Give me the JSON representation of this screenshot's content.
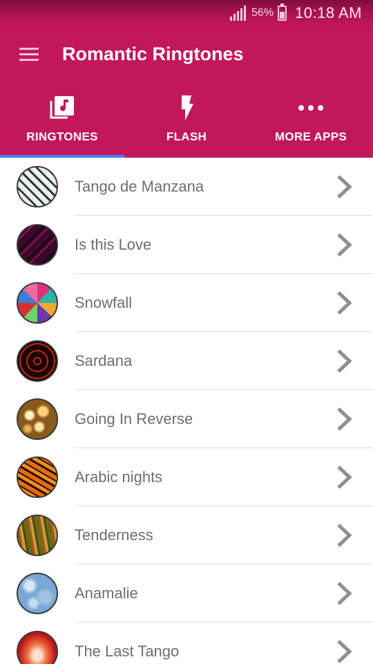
{
  "status_bar": {
    "battery_percent": "56%",
    "time": "10:18 AM"
  },
  "app_bar": {
    "menu_icon": "hamburger-menu-icon",
    "title": "Romantic Ringtones"
  },
  "tabs": [
    {
      "label": "RINGTONES",
      "icon": "music-library-icon",
      "selected": true
    },
    {
      "label": "FLASH",
      "icon": "flash-icon",
      "selected": false
    },
    {
      "label": "MORE APPS",
      "icon": "more-dots-icon",
      "selected": false
    }
  ],
  "theme": {
    "primary": "#c2185b",
    "tab_indicator": "#4a7ee8",
    "text_secondary": "#6e6e6e"
  },
  "ringtones": [
    {
      "name": "Tango de Manzana",
      "thumbnail": "diagonal-stripes"
    },
    {
      "name": "Is this Love",
      "thumbnail": "dark-magenta-stripes"
    },
    {
      "name": "Snowfall",
      "thumbnail": "colorful-triangles"
    },
    {
      "name": "Sardana",
      "thumbnail": "red-light-swirl"
    },
    {
      "name": "Going In Reverse",
      "thumbnail": "golden-bokeh"
    },
    {
      "name": "Arabic nights",
      "thumbnail": "orange-zebra"
    },
    {
      "name": "Tenderness",
      "thumbnail": "olive-curves"
    },
    {
      "name": "Anamalie",
      "thumbnail": "blue-watercolor"
    },
    {
      "name": "The Last Tango",
      "thumbnail": "red-glow"
    }
  ]
}
